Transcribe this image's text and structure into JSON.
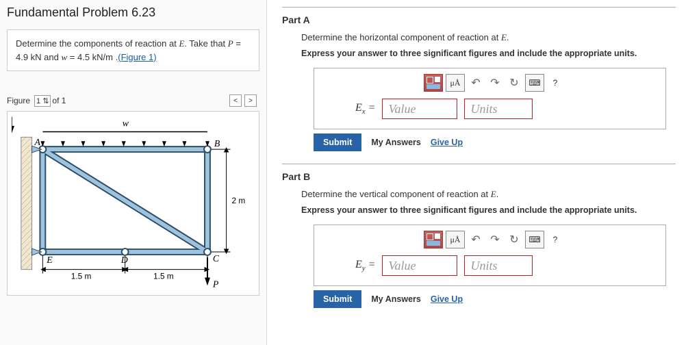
{
  "title": "Fundamental Problem 6.23",
  "prompt": {
    "text1": "Determine the components of reaction at ",
    "varE": "E",
    "text2": ". Take that ",
    "varP": "P",
    "text3": " = 4.9 kN and ",
    "varw": "w",
    "text4": " = 4.5 kN/m .",
    "figure_link": "(Figure 1)"
  },
  "figure_header": {
    "label": "Figure",
    "selector": "1",
    "of_text": "of 1",
    "prev": "<",
    "next": ">"
  },
  "figure_labels": {
    "w": "w",
    "A": "A",
    "B": "B",
    "C": "C",
    "D": "D",
    "E": "E",
    "P": "P",
    "d1": "1.5 m",
    "d2": "1.5 m",
    "h": "2 m"
  },
  "partA": {
    "title": "Part A",
    "desc_pre": "Determine the horizontal component of reaction at ",
    "desc_var": "E",
    "desc_post": ".",
    "instr": "Express your answer to three significant figures and include the appropriate units.",
    "var": "E",
    "sub": "x",
    "eq": " = ",
    "value_ph": "Value",
    "units_ph": "Units",
    "submit": "Submit",
    "my_answers": "My Answers",
    "give_up": "Give Up",
    "mu": "μÅ",
    "help": "?"
  },
  "partB": {
    "title": "Part B",
    "desc_pre": "Determine the vertical component of reaction at ",
    "desc_var": "E",
    "desc_post": ".",
    "instr": "Express your answer to three significant figures and include the appropriate units.",
    "var": "E",
    "sub": "y",
    "eq": " = ",
    "value_ph": "Value",
    "units_ph": "Units",
    "submit": "Submit",
    "my_answers": "My Answers",
    "give_up": "Give Up",
    "mu": "μÅ",
    "help": "?"
  }
}
